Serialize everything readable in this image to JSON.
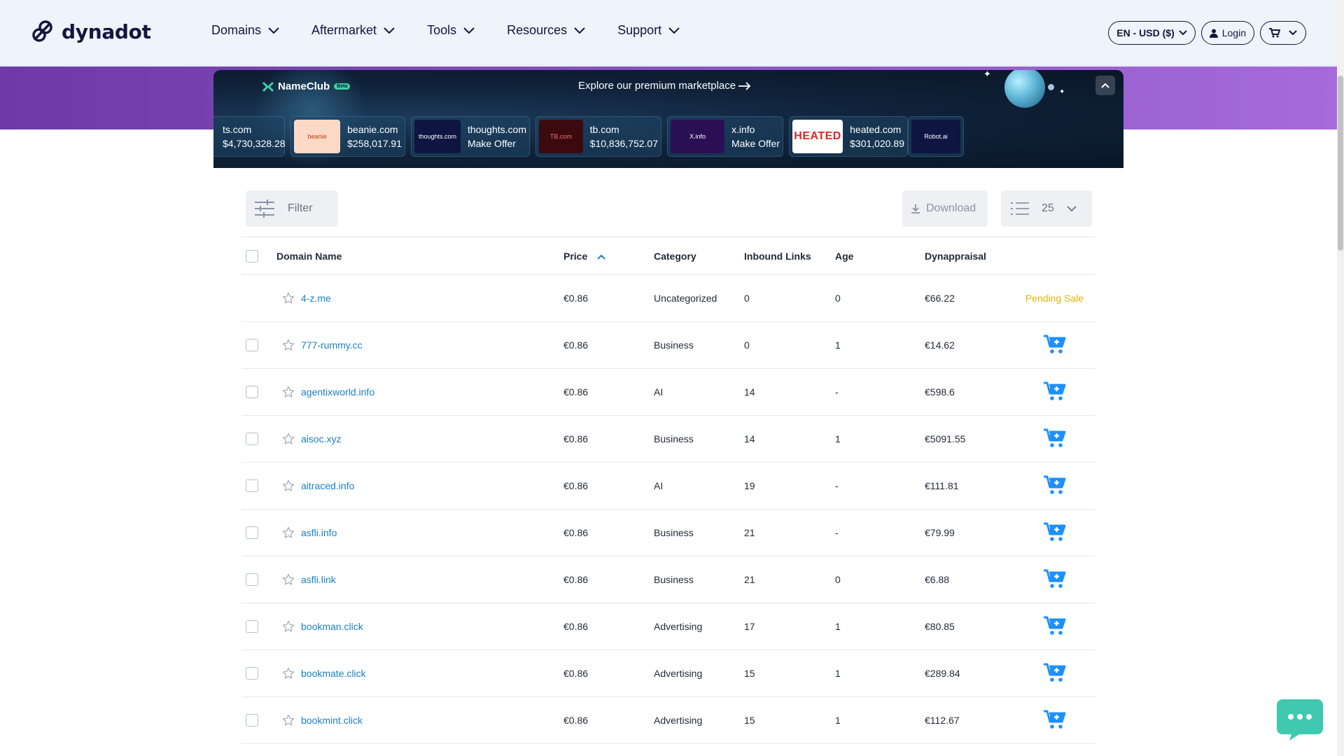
{
  "header": {
    "logo_text": "dynadot",
    "nav": [
      {
        "label": "Domains",
        "name": "nav-domains"
      },
      {
        "label": "Aftermarket",
        "name": "nav-aftermarket"
      },
      {
        "label": "Tools",
        "name": "nav-tools"
      },
      {
        "label": "Resources",
        "name": "nav-resources"
      },
      {
        "label": "Support",
        "name": "nav-support"
      }
    ],
    "language_currency": "EN - USD ($)",
    "login_label": "Login"
  },
  "banner": {
    "brand": "NameClub",
    "beta_badge": "Beta",
    "explore_text": "Explore our premium marketplace",
    "cards": [
      {
        "domain": "ts.com",
        "value": "$4,730,328.28",
        "thumb_text": "",
        "thumb_bg": "#3b1d5c",
        "thumb_color": "#ffffff"
      },
      {
        "domain": "beanie.com",
        "value": "$258,017.91",
        "thumb_text": "beanie",
        "thumb_bg": "#fbd9c6",
        "thumb_color": "#c2410c"
      },
      {
        "domain": "thoughts.com",
        "value": "Make Offer",
        "thumb_text": "thoughts.com",
        "thumb_bg": "#0d1540",
        "thumb_color": "#ffffff"
      },
      {
        "domain": "tb.com",
        "value": "$10,836,752.07",
        "thumb_text": "TB.com",
        "thumb_bg": "#3a0a0f",
        "thumb_color": "#f87171"
      },
      {
        "domain": "x.info",
        "value": "Make Offer",
        "thumb_text": "X.info",
        "thumb_bg": "#2b0f55",
        "thumb_color": "#ffffff"
      },
      {
        "domain": "heated.com",
        "value": "$301,020.89",
        "thumb_text": "HEATED",
        "thumb_bg": "#ffffff",
        "thumb_color": "#dc2626"
      },
      {
        "domain": "",
        "value": "",
        "thumb_text": "Robot.ai",
        "thumb_bg": "#0d1540",
        "thumb_color": "#ffffff"
      }
    ]
  },
  "toolbar": {
    "filter_label": "Filter",
    "download_label": "Download",
    "page_size": "25"
  },
  "table": {
    "columns": [
      "Domain Name",
      "Price",
      "Category",
      "Inbound Links",
      "Age",
      "Dynappraisal"
    ],
    "rows": [
      {
        "domain": "4-z.me",
        "price": "€0.86",
        "category": "Uncategorized",
        "links": "0",
        "age": "0",
        "appraisal": "€66.22",
        "status": "Pending Sale"
      },
      {
        "domain": "777-rummy.cc",
        "price": "€0.86",
        "category": "Business",
        "links": "0",
        "age": "1",
        "appraisal": "€14.62",
        "status": ""
      },
      {
        "domain": "agentixworld.info",
        "price": "€0.86",
        "category": "AI",
        "links": "14",
        "age": "-",
        "appraisal": "€598.6",
        "status": ""
      },
      {
        "domain": "aisoc.xyz",
        "price": "€0.86",
        "category": "Business",
        "links": "14",
        "age": "1",
        "appraisal": "€5091.55",
        "status": ""
      },
      {
        "domain": "aitraced.info",
        "price": "€0.86",
        "category": "AI",
        "links": "19",
        "age": "-",
        "appraisal": "€111.81",
        "status": ""
      },
      {
        "domain": "asfli.info",
        "price": "€0.86",
        "category": "Business",
        "links": "21",
        "age": "-",
        "appraisal": "€79.99",
        "status": ""
      },
      {
        "domain": "asfli.link",
        "price": "€0.86",
        "category": "Business",
        "links": "21",
        "age": "0",
        "appraisal": "€6.88",
        "status": ""
      },
      {
        "domain": "bookman.click",
        "price": "€0.86",
        "category": "Advertising",
        "links": "17",
        "age": "1",
        "appraisal": "€80.85",
        "status": ""
      },
      {
        "domain": "bookmate.click",
        "price": "€0.86",
        "category": "Advertising",
        "links": "15",
        "age": "1",
        "appraisal": "€289.84",
        "status": ""
      },
      {
        "domain": "bookmint.click",
        "price": "€0.86",
        "category": "Advertising",
        "links": "15",
        "age": "1",
        "appraisal": "€112.67",
        "status": ""
      }
    ]
  },
  "colors": {
    "link": "#1a7fc9",
    "cart": "#1e90ff",
    "pending": "#eab308",
    "chat": "#3ec9b0"
  }
}
